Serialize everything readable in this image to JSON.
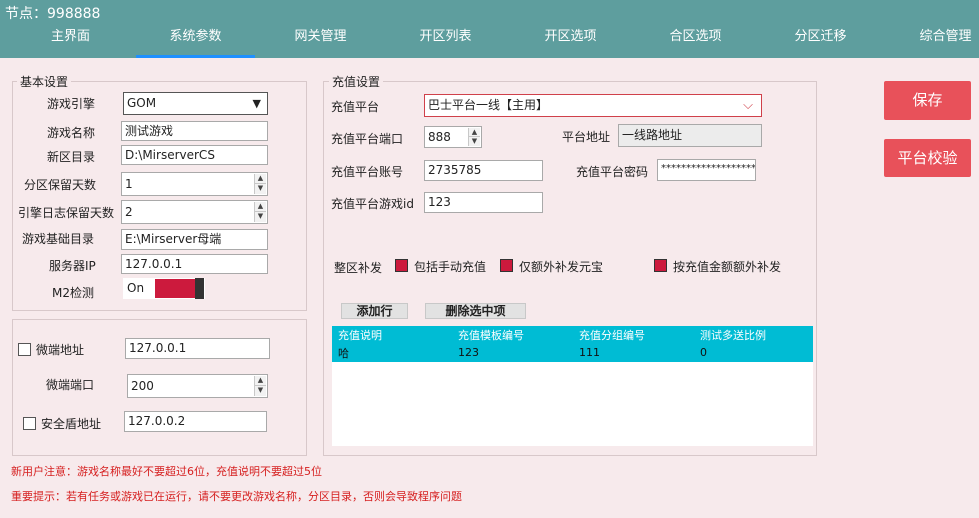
{
  "header": {
    "node_label": "节点：998888"
  },
  "tabs": [
    {
      "label": "主界面"
    },
    {
      "label": "系统参数"
    },
    {
      "label": "网关管理"
    },
    {
      "label": "开区列表"
    },
    {
      "label": "开区选项"
    },
    {
      "label": "合区选项"
    },
    {
      "label": "分区迁移"
    },
    {
      "label": "综合管理"
    }
  ],
  "active_tab": "系统参数",
  "basic": {
    "legend": "基本设置",
    "engine_label": "游戏引擎",
    "engine_value": "GOM",
    "game_name_label": "游戏名称",
    "game_name_value": "测试游戏",
    "new_dir_label": "新区目录",
    "new_dir_value": "D:\\MirserverCS",
    "keep_days_label": "分区保留天数",
    "keep_days_value": "1",
    "log_days_label": "引擎日志保留天数",
    "log_days_value": "2",
    "base_dir_label": "游戏基础目录",
    "base_dir_value": "E:\\Mirserver母端",
    "server_ip_label": "服务器IP",
    "server_ip_value": "127.0.0.1",
    "m2_label": "M2检测",
    "m2_state": "On"
  },
  "micro": {
    "micro_addr_label": "微端地址",
    "micro_addr_value": "127.0.0.1",
    "micro_port_label": "微端端口",
    "micro_port_value": "200",
    "shield_label": "安全盾地址",
    "shield_value": "127.0.0.2"
  },
  "recharge": {
    "legend": "充值设置",
    "platform_label": "充值平台",
    "platform_value": "巴士平台一线【主用】",
    "port_label": "充值平台端口",
    "port_value": "888",
    "addr_label": "平台地址",
    "addr_value": "一线路地址",
    "account_label": "充值平台账号",
    "account_value": "2735785",
    "password_label": "充值平台密码",
    "password_value": "********************",
    "gameid_label": "充值平台游戏id",
    "gameid_value": "123",
    "makeup_label": "整区补发",
    "opt_manual": "包括手动充值",
    "opt_extra": "仅额外补发元宝",
    "opt_amount": "按充值金额额外补发",
    "add_row": "添加行",
    "delete_row": "删除选中项",
    "columns": [
      "充值说明",
      "充值模板编号",
      "充值分组编号",
      "测试多送比例"
    ],
    "rows": [
      [
        "哈",
        "123",
        "111",
        "0"
      ]
    ]
  },
  "actions": {
    "save": "保存",
    "verify": "平台校验"
  },
  "notes": {
    "new_user": "新用户注意：游戏名称最好不要超过6位，充值说明不要超过5位",
    "important": "重要提示：若有任务或游戏已在运行，请不要更改游戏名称，分区目录，否则会导致程序问题"
  },
  "colors": {
    "titlebar": "#5e9e9e",
    "accent_red": "#e8515a",
    "grid": "#00bcd4",
    "check_on": "#cc1a3d"
  }
}
